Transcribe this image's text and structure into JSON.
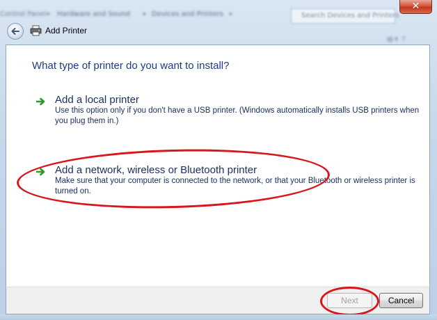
{
  "window": {
    "title": "Add Printer",
    "close_label": "✕"
  },
  "breadcrumb": {
    "segments": [
      "Control Panel",
      "Hardware and Sound",
      "Devices and Printers"
    ],
    "search_placeholder": "Search Devices and Printers"
  },
  "content": {
    "heading": "What type of printer do you want to install?",
    "options": [
      {
        "title": "Add a local printer",
        "description": "Use this option only if you don't have a USB printer. (Windows automatically installs USB printers when you plug them in.)"
      },
      {
        "title": "Add a network, wireless or Bluetooth printer",
        "description": "Make sure that your computer is connected to the network, or that your Bluetooth or wireless printer is turned on."
      }
    ]
  },
  "footer": {
    "next_label": "Next",
    "cancel_label": "Cancel"
  },
  "colors": {
    "heading": "#1e3a87",
    "annotation": "#d8161c",
    "arrow": "#2e9b2a"
  },
  "icons": {
    "back": "back-arrow-icon",
    "printer": "printer-icon",
    "option_arrow": "green-arrow-icon",
    "close": "close-icon"
  }
}
